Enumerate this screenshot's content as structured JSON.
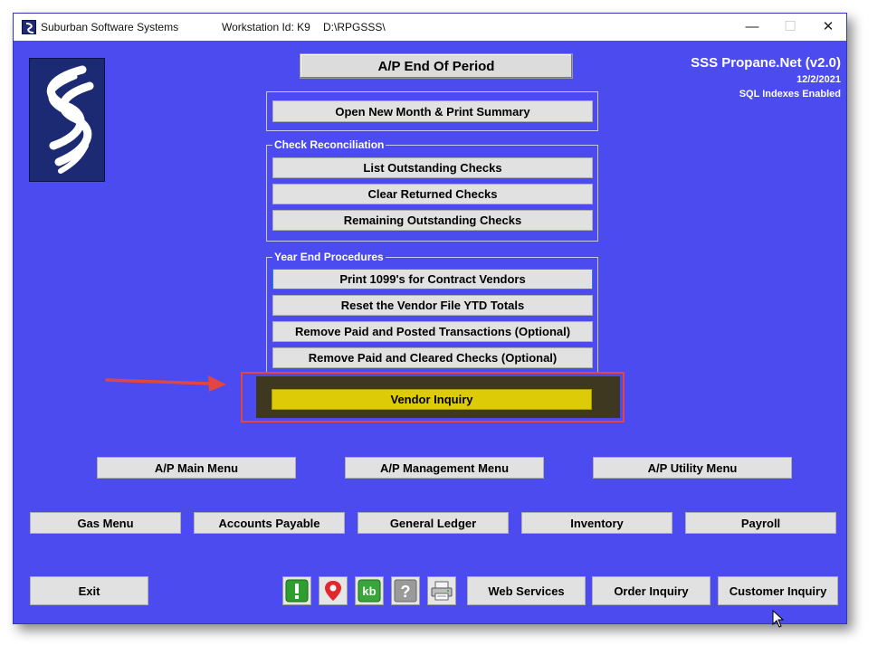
{
  "titlebar": {
    "app_name": "Suburban Software Systems",
    "workstation": "Workstation Id: K9",
    "path": "D:\\RPGSSS\\",
    "minimize": "—",
    "maximize": "☐",
    "close": "✕"
  },
  "screen_title": "A/P End Of Period",
  "info": {
    "product": "SSS Propane.Net (v2.0)",
    "date": "12/2/2021",
    "sql": "SQL Indexes Enabled"
  },
  "buttons": {
    "open_new_month": "Open New Month & Print Summary",
    "list_outstanding": "List Outstanding Checks",
    "clear_returned": "Clear Returned Checks",
    "remaining_outstanding": "Remaining Outstanding Checks",
    "print_1099": "Print 1099's for Contract Vendors",
    "reset_vendor_ytd": "Reset the Vendor File YTD Totals",
    "remove_paid_posted": "Remove Paid and Posted Transactions  (Optional)",
    "remove_paid_cleared": "Remove Paid and Cleared Checks  (Optional)",
    "vendor_inquiry": "Vendor Inquiry",
    "ap_main_menu": "A/P Main Menu",
    "ap_management_menu": "A/P Management Menu",
    "ap_utility_menu": "A/P Utility Menu",
    "gas_menu": "Gas Menu",
    "accounts_payable": "Accounts Payable",
    "general_ledger": "General Ledger",
    "inventory": "Inventory",
    "payroll": "Payroll",
    "exit": "Exit",
    "web_services": "Web Services",
    "order_inquiry": "Order Inquiry",
    "customer_inquiry": "Customer Inquiry"
  },
  "groups": {
    "check_reconciliation": "Check Reconciliation",
    "year_end": "Year End Procedures"
  },
  "icons": [
    "alert-icon",
    "map-pin-icon",
    "kb-icon",
    "help-icon",
    "printer-icon"
  ],
  "colors": {
    "background": "#4b4bf0",
    "button": "#e1e1e1",
    "vendor_inquiry": "#dccb06",
    "highlight_border": "#e2463f"
  }
}
